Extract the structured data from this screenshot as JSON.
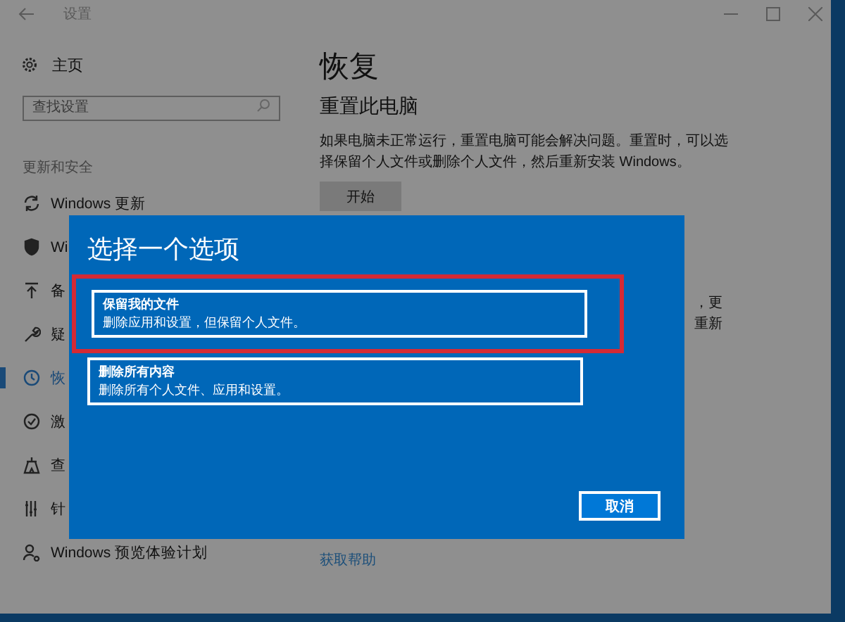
{
  "window": {
    "title": "设置"
  },
  "sidebar": {
    "home": "主页",
    "search": {
      "placeholder": "查找设置"
    },
    "section": "更新和安全",
    "items": [
      {
        "label": "Windows 更新",
        "selected": false
      },
      {
        "label": "Wi",
        "selected": false
      },
      {
        "label": "备",
        "selected": false
      },
      {
        "label": "疑",
        "selected": false
      },
      {
        "label": "恢",
        "selected": true
      },
      {
        "label": "激",
        "selected": false
      },
      {
        "label": "查",
        "selected": false
      },
      {
        "label": "针",
        "selected": false
      },
      {
        "label": "Windows 预览体验计划",
        "selected": false
      }
    ]
  },
  "main": {
    "heading": "恢复",
    "section_title": "重置此电脑",
    "description": "如果电脑未正常运行，重置电脑可能会解决问题。重置时，可以选择保留个人文件或删除个人文件，然后重新安装 Windows。",
    "start_button": "开始",
    "partial_lines": [
      "，更",
      "重新"
    ],
    "help_link": "获取帮助"
  },
  "dialog": {
    "title": "选择一个选项",
    "options": [
      {
        "title": "保留我的文件",
        "description": "删除应用和设置，但保留个人文件。",
        "highlighted": true
      },
      {
        "title": "删除所有内容",
        "description": "删除所有个人文件、应用和设置。",
        "highlighted": false
      }
    ],
    "cancel": "取消"
  }
}
